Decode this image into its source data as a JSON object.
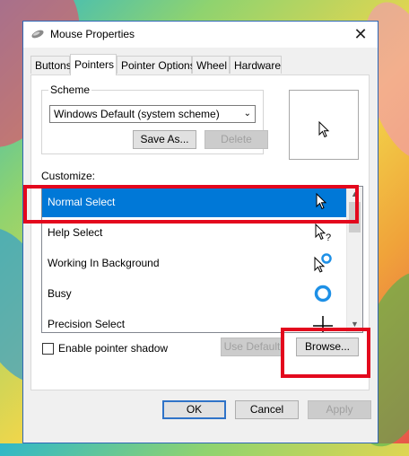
{
  "window": {
    "title": "Mouse Properties",
    "close_glyph": "✕"
  },
  "tabs": [
    {
      "label": "Buttons",
      "active": false
    },
    {
      "label": "Pointers",
      "active": true
    },
    {
      "label": "Pointer Options",
      "active": false
    },
    {
      "label": "Wheel",
      "active": false
    },
    {
      "label": "Hardware",
      "active": false
    }
  ],
  "scheme": {
    "label": "Scheme",
    "selected": "Windows Default (system scheme)",
    "save_as_label": "Save As...",
    "delete_label": "Delete"
  },
  "customize": {
    "label": "Customize:",
    "items": [
      {
        "label": "Normal Select",
        "cursor": "arrow-cursor-icon",
        "selected": true
      },
      {
        "label": "Help Select",
        "cursor": "help-cursor-icon",
        "selected": false
      },
      {
        "label": "Working In Background",
        "cursor": "working-cursor-icon",
        "selected": false
      },
      {
        "label": "Busy",
        "cursor": "busy-cursor-icon",
        "selected": false
      },
      {
        "label": "Precision Select",
        "cursor": "crosshair-cursor-icon",
        "selected": false
      }
    ]
  },
  "options": {
    "enable_shadow_label": "Enable pointer shadow",
    "enable_shadow_checked": false,
    "use_default_label": "Use Default",
    "browse_label": "Browse..."
  },
  "footer": {
    "ok_label": "OK",
    "cancel_label": "Cancel",
    "apply_label": "Apply"
  },
  "colors": {
    "selection": "#0078d7",
    "annotation": "#e3081d",
    "busy_ring": "#1e90e6"
  }
}
